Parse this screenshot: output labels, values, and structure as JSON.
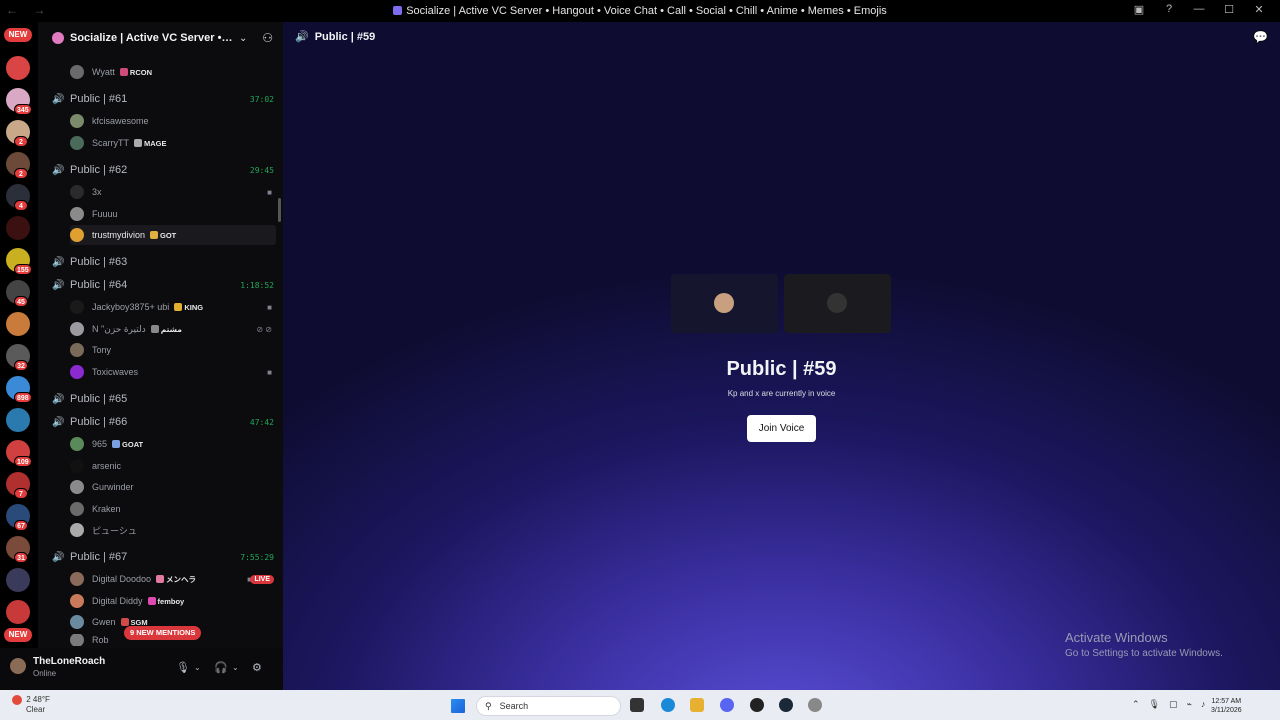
{
  "window": {
    "title": "Socialize | Active VC Server • Hangout • Voice Chat • Call • Social • Chill • Anime • Memes • Emojis"
  },
  "rail": {
    "new_top": "NEW",
    "new_bottom": "NEW",
    "counts": [
      "3",
      "345",
      "2",
      "2",
      "4",
      "155",
      "45",
      "32",
      "898",
      "109",
      "7",
      "67",
      "31",
      "1"
    ]
  },
  "server": {
    "name": "Socialize | Active VC Server • Han..."
  },
  "sidebar": {
    "partial_user": {
      "name": "Wyatt",
      "tag": "RCON"
    },
    "channels": [
      {
        "name": "Public | #61",
        "time": "37:02",
        "users": [
          {
            "name": "kfcisawesome",
            "tag": ""
          },
          {
            "name": "ScarryTT",
            "tag": "MAGE"
          }
        ]
      },
      {
        "name": "Public | #62",
        "time": "29:45",
        "users": [
          {
            "name": "3x",
            "tag": ""
          },
          {
            "name": "Fuuuu",
            "tag": ""
          },
          {
            "name": "trustmydivion",
            "tag": "GOT"
          }
        ]
      },
      {
        "name": "Public | #63",
        "time": "",
        "users": []
      },
      {
        "name": "Public | #64",
        "time": "1:18:52",
        "users": [
          {
            "name": "Jackyboy3875+ ubi",
            "tag": "KING"
          },
          {
            "name": "N \"دلتيرة حزن",
            "tag": "مشتم"
          },
          {
            "name": "Tony",
            "tag": ""
          },
          {
            "name": "Toxicwaves",
            "tag": ""
          }
        ]
      },
      {
        "name": "Public | #65",
        "time": "",
        "users": []
      },
      {
        "name": "Public | #66",
        "time": "47:42",
        "users": [
          {
            "name": "965",
            "tag": "GOAT"
          },
          {
            "name": "arsenic",
            "tag": ""
          },
          {
            "name": "Gurwinder",
            "tag": ""
          },
          {
            "name": "Kraken",
            "tag": ""
          },
          {
            "name": "ピューシュ",
            "tag": ""
          }
        ]
      },
      {
        "name": "Public | #67",
        "time": "7:55:29",
        "users": [
          {
            "name": "Digital Doodoo",
            "tag": "メンヘラ"
          },
          {
            "name": "Digital Diddy",
            "tag": "femboy"
          },
          {
            "name": "Gwen",
            "tag": "SGM"
          },
          {
            "name": "Rob",
            "tag": ""
          }
        ]
      }
    ],
    "live_label": "LIVE",
    "mentions_pill": "9 NEW MENTIONS"
  },
  "user_panel": {
    "name": "TheLoneRoach",
    "status": "Online"
  },
  "main": {
    "header_title": "Public | #59",
    "vc_title": "Public | #59",
    "vc_subtitle": "Kp and x are currently in voice",
    "join_label": "Join Voice"
  },
  "watermark": {
    "line1": "Activate Windows",
    "line2": "Go to Settings to activate Windows."
  },
  "taskbar": {
    "temperature": "48°F",
    "condition": "Clear",
    "search_placeholder": "Search",
    "time": "12:57 AM",
    "date": "3/11/2026",
    "weather_badge": "2"
  },
  "colors": {
    "voice_green": "#23a559",
    "badge_red": "#da373c",
    "main_gradient_center": "#5a4fd8"
  }
}
